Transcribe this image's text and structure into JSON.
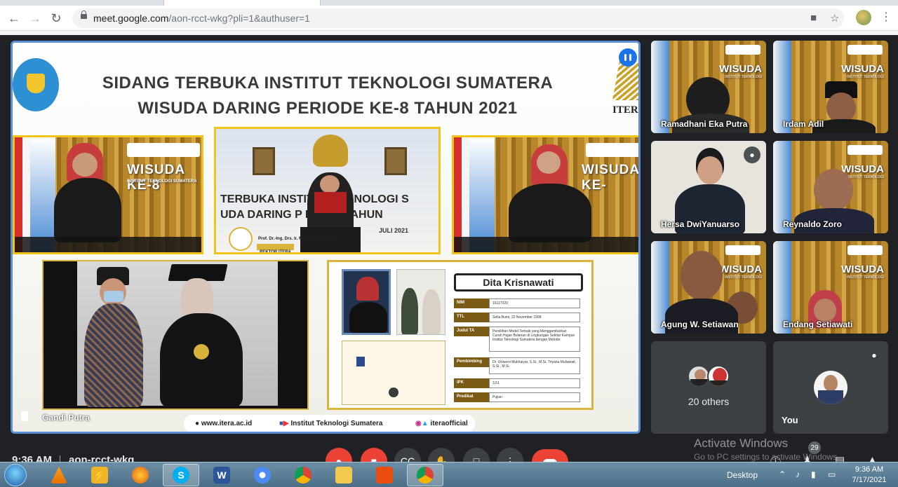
{
  "browser": {
    "url_host": "meet.google.com",
    "url_path": "/aon-rcct-wkg?pli=1&authuser=1"
  },
  "slide": {
    "title_line1": "SIDANG TERBUKA INSTITUT TEKNOLOGI SUMATERA",
    "title_line2": "WISUDA DARING PERIODE KE-8 TAHUN 2021",
    "itera_label": "ITERA",
    "wisuda_banner": "WISUDA KE-8",
    "wisuda_small": "INSTITUT TEKNOLOGI SUMATERA",
    "wisuda_banner_right": "WISUDA KE-",
    "podium_title_1": "TERBUKA INSTITUT TEKNOLOGI S",
    "podium_title_2": "UDA DARING P      E KE-8 TAHUN",
    "podium_date": "JULI 2021",
    "podium_caption": "Prof. Dr.-Ing. Drs. Ir. Mitra Djamal, IPU.",
    "podium_role": "REKTOR ITERA",
    "graduate": {
      "name": "Dita Krisnawati",
      "fields": [
        {
          "label": "NIM",
          "value": "16117020"
        },
        {
          "label": "TTL",
          "value": "Setia Bumi, 22 November 1998"
        },
        {
          "label": "Judul TA",
          "value": "Pemilihan Model Terbaik yang Menggambarkan Curah Hujan Bulanan di Lingkungan Sekitar Kampus Institut Teknologi Sumatera dengan Metode"
        },
        {
          "label": "Pembimbing",
          "value": "Dr. Utriweni Mukhaiyar, S.Si., M.Si. Triyana Muliawati, S.Si., M.Si."
        },
        {
          "label": "IPK",
          "value": "3,51"
        },
        {
          "label": "Predikat",
          "value": "Pujian"
        }
      ]
    },
    "footer": {
      "website": "www.itera.ac.id",
      "social_name": "Institut Teknologi Sumatera",
      "handle": "iteraofficial"
    }
  },
  "main_speaker": "Gandi Putra",
  "participants": [
    {
      "name": "Ramadhani Eka Putra",
      "muted": false
    },
    {
      "name": "Irdam Adil",
      "muted": false
    },
    {
      "name": "Hersa DwiYanuarso",
      "muted": true
    },
    {
      "name": "Reynaldo Zoro",
      "muted": false
    },
    {
      "name": "Agung W. Setiawan",
      "muted": false
    },
    {
      "name": "Endang Setiawati",
      "muted": false
    }
  ],
  "others_tile": {
    "label": "20 others"
  },
  "you_tile": {
    "label": "You"
  },
  "tile_wisuda": "WISUDA",
  "tile_wisuda_small": "INSTITUT TEKNOLOGI",
  "meeting": {
    "time": "9:36 AM",
    "code": "aon-rcct-wkg",
    "people_count": "29"
  },
  "activate": {
    "line1": "Activate Windows",
    "line2": "Go to PC settings to activate Windows."
  },
  "taskbar": {
    "desktop_label": "Desktop",
    "clock_time": "9:36 AM",
    "clock_date": "7/17/2021"
  },
  "colors": {
    "meet_bg": "#202124",
    "active_border": "#5a8fd8",
    "hangup_red": "#ea4335",
    "gold_frame": "#f0c419"
  }
}
